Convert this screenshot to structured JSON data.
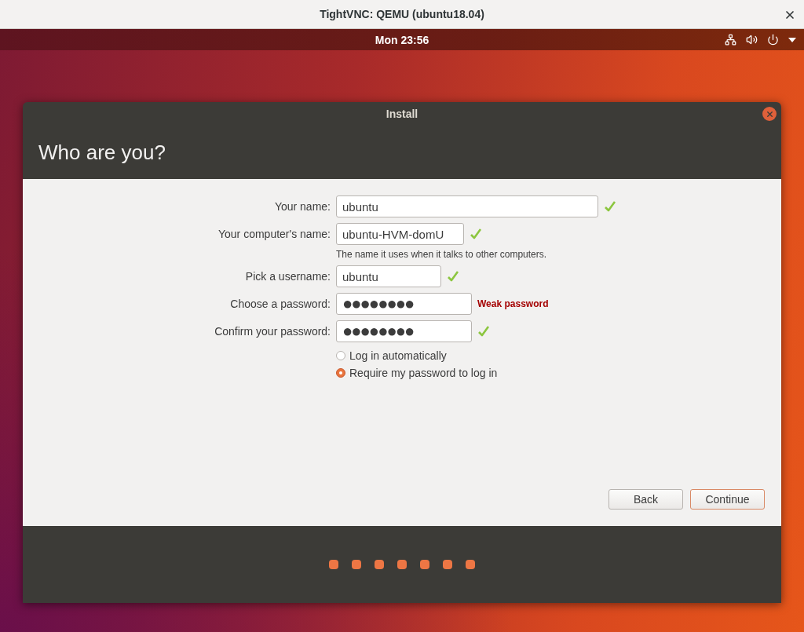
{
  "vnc_window": {
    "title": "TightVNC: QEMU (ubuntu18.04)"
  },
  "top_panel": {
    "clock": "Mon 23:56"
  },
  "installer": {
    "title": "Install",
    "heading": "Who are you?",
    "fields": [
      {
        "kind": "text",
        "label": "Your name:",
        "value": "ubuntu",
        "valid": true
      },
      {
        "kind": "text",
        "label": "Your computer's name:",
        "value": "ubuntu-HVM-domU",
        "valid": true,
        "hint": "The name it uses when it talks to other computers."
      },
      {
        "kind": "text",
        "label": "Pick a username:",
        "value": "ubuntu",
        "valid": true
      },
      {
        "kind": "password",
        "label": "Choose a password:",
        "value": "●●●●●●●●",
        "valid": false,
        "strength": "Weak password"
      },
      {
        "kind": "password",
        "label": "Confirm your password:",
        "value": "●●●●●●●●",
        "valid": true
      }
    ],
    "login_options": [
      {
        "label": "Log in automatically",
        "selected": false
      },
      {
        "label": "Require my password to log in",
        "selected": true
      }
    ],
    "buttons": [
      {
        "label": "Back",
        "default": false
      },
      {
        "label": "Continue",
        "default": true
      }
    ]
  }
}
